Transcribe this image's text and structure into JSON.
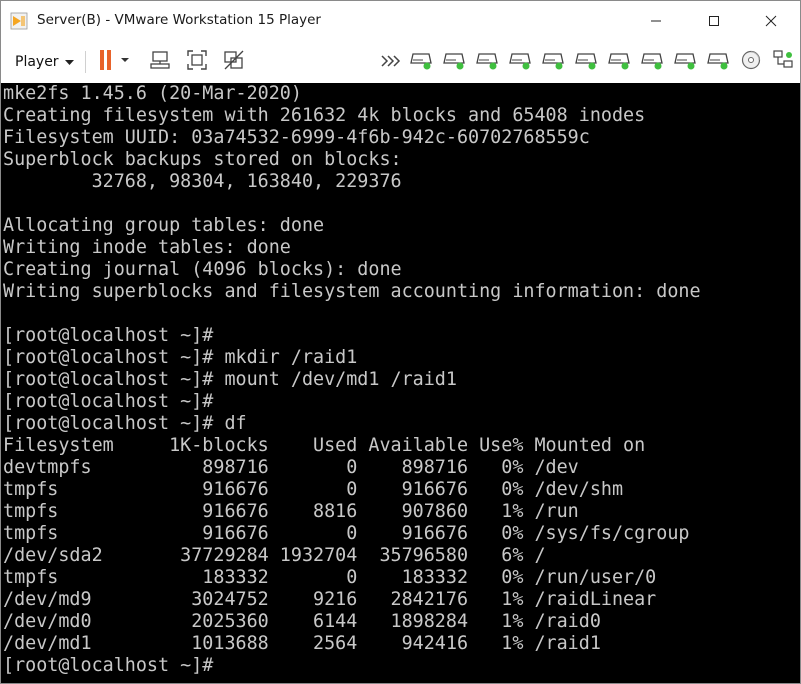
{
  "window": {
    "title": "Server(B) - VMware Workstation 15 Player",
    "app_icon": "vmware-player-icon",
    "controls": [
      "minimize-icon",
      "maximize-icon",
      "close-icon"
    ]
  },
  "toolbar": {
    "player_label": "Player",
    "left_icons": [
      "pause-icon",
      "send-ctrl-alt-del-icon",
      "fit-guest-icon",
      "unity-icon"
    ],
    "right_icons": [
      "more-devices-icon",
      "hard-disk-icon",
      "hard-disk-icon",
      "hard-disk-icon",
      "hard-disk-icon",
      "hard-disk-icon",
      "hard-disk-icon",
      "hard-disk-icon",
      "hard-disk-icon",
      "cd-dvd-icon",
      "network-icon"
    ],
    "colors": {
      "pause": "#e8632b",
      "disk_activity": "#3fbf3f"
    }
  },
  "terminal": {
    "background": "#000000",
    "foreground": "#c8c8c8",
    "lines": [
      "mke2fs 1.45.6 (20-Mar-2020)",
      "Creating filesystem with 261632 4k blocks and 65408 inodes",
      "Filesystem UUID: 03a74532-6999-4f6b-942c-60702768559c",
      "Superblock backups stored on blocks:",
      "        32768, 98304, 163840, 229376",
      "",
      "Allocating group tables: done",
      "Writing inode tables: done",
      "Creating journal (4096 blocks): done",
      "Writing superblocks and filesystem accounting information: done",
      "",
      "[root@localhost ~]#",
      "[root@localhost ~]# mkdir /raid1",
      "[root@localhost ~]# mount /dev/md1 /raid1",
      "[root@localhost ~]#",
      "[root@localhost ~]# df",
      "Filesystem     1K-blocks    Used Available Use% Mounted on",
      "devtmpfs          898716       0    898716   0% /dev",
      "tmpfs             916676       0    916676   0% /dev/shm",
      "tmpfs             916676    8816    907860   1% /run",
      "tmpfs             916676       0    916676   0% /sys/fs/cgroup",
      "/dev/sda2       37729284 1932704  35796580   6% /",
      "tmpfs             183332       0    183332   0% /run/user/0",
      "/dev/md9         3024752    9216   2842176   1% /raidLinear",
      "/dev/md0         2025360    6144   1898284   1% /raid0",
      "/dev/md1         1013688    2564    942416   1% /raid1",
      "[root@localhost ~]#"
    ]
  }
}
